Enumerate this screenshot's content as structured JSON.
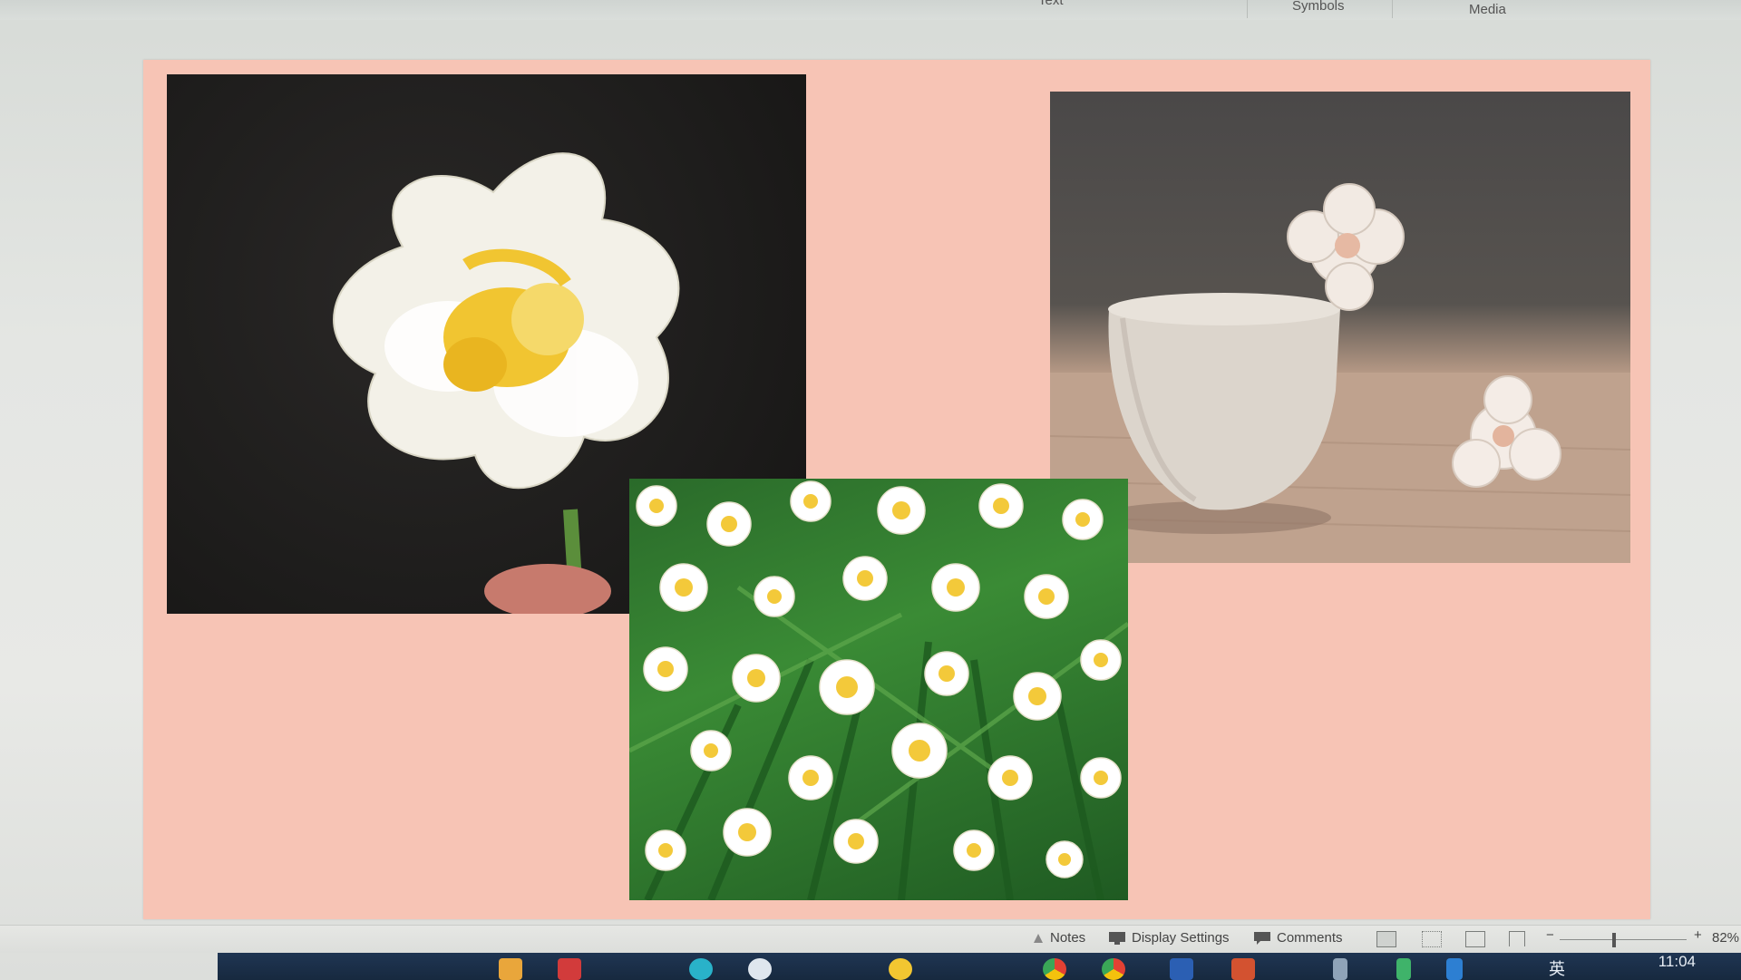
{
  "ribbon": {
    "groups": [
      "Text",
      "Symbols",
      "Media"
    ]
  },
  "statusbar": {
    "notes_label": "Notes",
    "display_settings_label": "Display Settings",
    "comments_label": "Comments",
    "zoom_minus": "−",
    "zoom_plus": "+",
    "zoom_level": "82%"
  },
  "taskbar": {
    "time": "11:04",
    "ime_label": "英"
  },
  "colors": {
    "slide_background": "#f7c4b5",
    "taskbar": "#1a2e48"
  }
}
